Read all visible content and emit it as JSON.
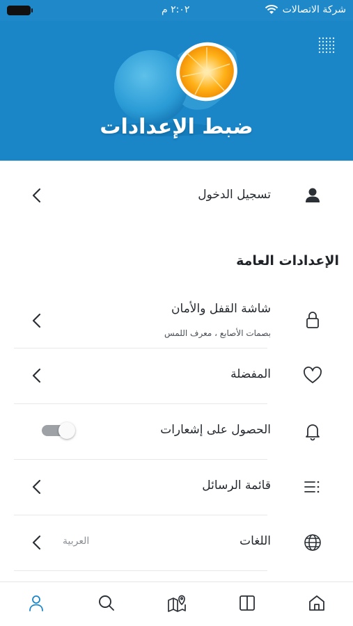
{
  "status_bar": {
    "time": "٢:٠٢ م",
    "carrier": "شركة الاتصالات"
  },
  "hero": {
    "title": "ضبط الإعدادات"
  },
  "login": {
    "label": "تسجيل الدخول",
    "icon": "user-icon"
  },
  "general_section": {
    "title": "الإعدادات العامة",
    "items": [
      {
        "label": "شاشة القفل والأمان",
        "subtitle": "بصمات الأصابع ، معرف اللمس",
        "icon": "lock-icon"
      },
      {
        "label": "المفضلة",
        "icon": "heart-icon"
      },
      {
        "label": "الحصول على إشعارات",
        "icon": "bell-icon",
        "toggle_on": true
      },
      {
        "label": "قائمة الرسائل",
        "icon": "list-icon"
      },
      {
        "label": "اللغات",
        "value": "العربية",
        "icon": "globe-icon"
      }
    ]
  },
  "tab_bar": {
    "items": [
      "home-icon",
      "book-icon",
      "map-icon",
      "search-icon",
      "profile-icon"
    ],
    "active": "profile-icon",
    "active_color": "#1a86c8"
  },
  "colors": {
    "hero_bg": "#1a86c8",
    "status_bg": "#1e88c9"
  }
}
